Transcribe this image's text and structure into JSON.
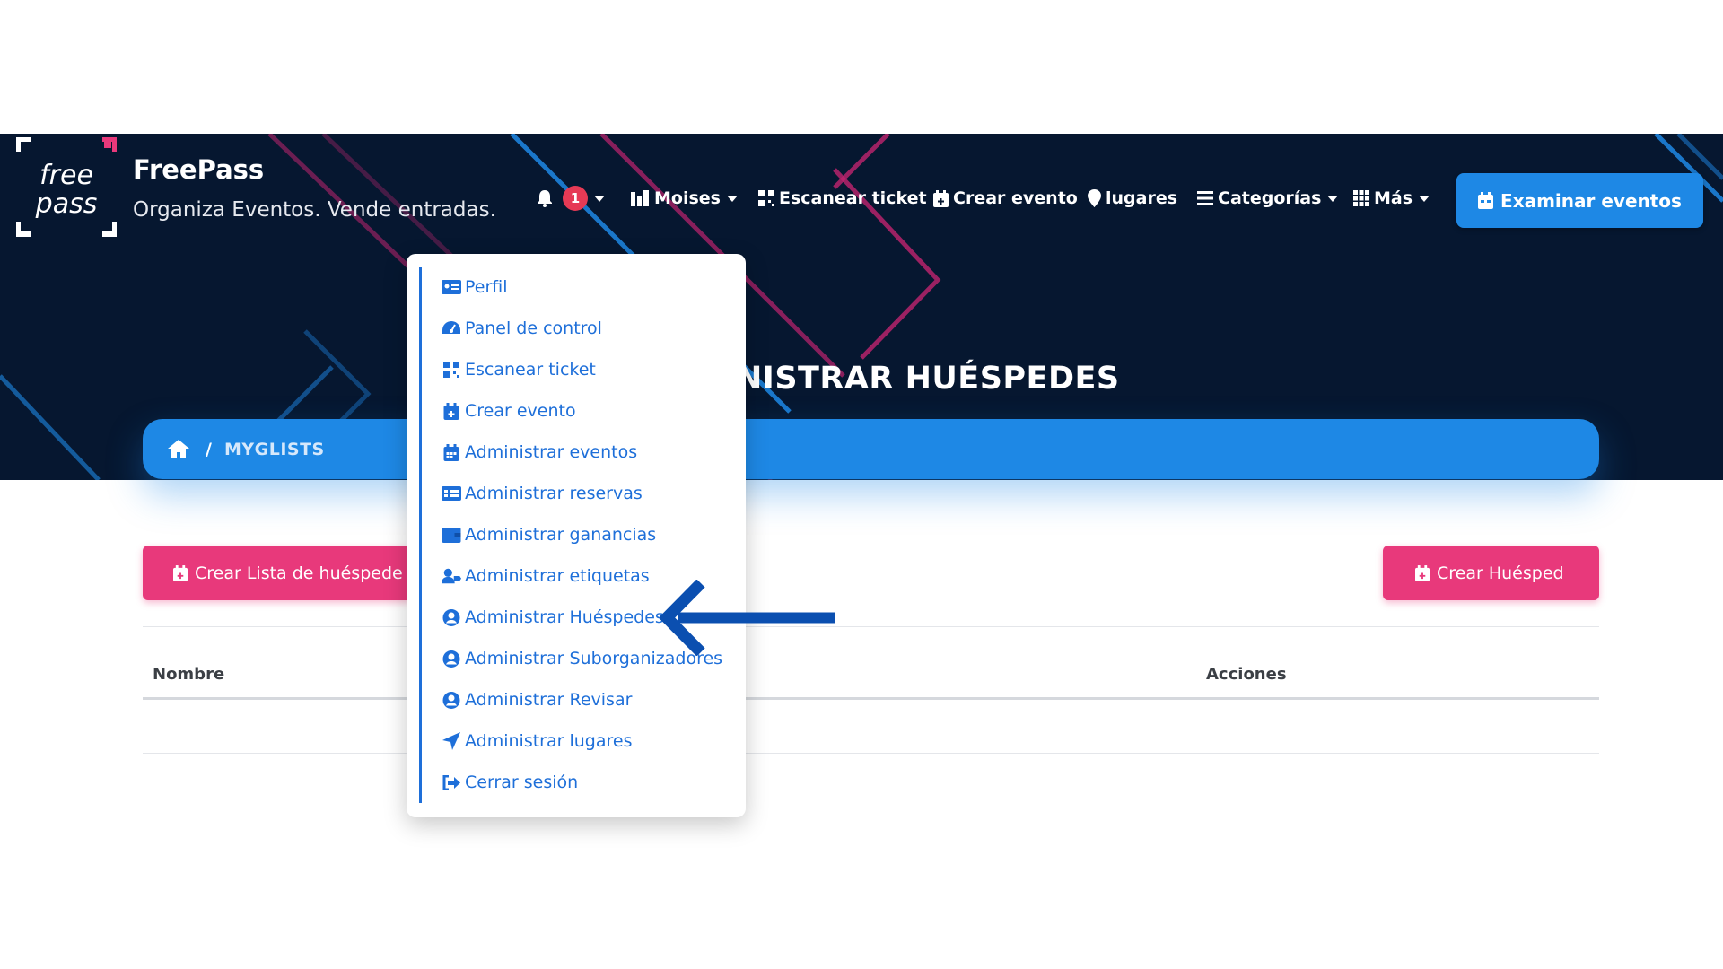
{
  "header": {
    "brand_name": "FreePass",
    "tagline": "Organiza Eventos. Vende entradas.",
    "logo_text_1": "free",
    "logo_text_2": "pass",
    "accent_color": "#e8397b"
  },
  "nav": {
    "notifications": {
      "icon": "bell-icon",
      "count": "1"
    },
    "user_menu": {
      "icon": "user-dashboard-icon",
      "label": "Moises"
    },
    "scan_ticket": {
      "icon": "qrcode-icon",
      "label": "Escanear ticket"
    },
    "create_event": {
      "icon": "calendar-plus-icon",
      "label": "Crear evento"
    },
    "venues": {
      "icon": "map-pin-icon",
      "label": "lugares"
    },
    "categories": {
      "icon": "list-icon",
      "label": "Categorías"
    },
    "more": {
      "icon": "grid-icon",
      "label": "Más"
    },
    "browse_events": {
      "icon": "calendar-icon",
      "label": "Examinar eventos",
      "color": "#1e88e5"
    }
  },
  "page": {
    "heading_visible": "NISTRAR HUÉSPEDES",
    "breadcrumb": {
      "home_icon": "home-icon",
      "separator": "/",
      "current": "MYGLISTS"
    }
  },
  "actions": {
    "create_list_label": "Crear Lista de huéspede",
    "create_guest_label": "Crear Huésped"
  },
  "table": {
    "columns": [
      "Nombre",
      "Acciones"
    ]
  },
  "dropdown": {
    "items": [
      {
        "icon": "id-card-icon",
        "label": "Perfil"
      },
      {
        "icon": "dashboard-gauge-icon",
        "label": "Panel de control"
      },
      {
        "icon": "qrcode-icon",
        "label": "Escanear ticket"
      },
      {
        "icon": "calendar-plus-icon",
        "label": "Crear evento"
      },
      {
        "icon": "calendar-icon",
        "label": "Administrar eventos"
      },
      {
        "icon": "list-card-icon",
        "label": "Administrar reservas"
      },
      {
        "icon": "wallet-icon",
        "label": "Administrar ganancias"
      },
      {
        "icon": "user-tag-icon",
        "label": "Administrar etiquetas"
      },
      {
        "icon": "user-circle-icon",
        "label": "Administrar Huéspedes"
      },
      {
        "icon": "user-circle-icon",
        "label": "Administrar Suborganizadores"
      },
      {
        "icon": "user-circle-icon",
        "label": "Administrar Revisar"
      },
      {
        "icon": "location-arrow-icon",
        "label": "Administrar lugares"
      },
      {
        "icon": "sign-out-icon",
        "label": "Cerrar sesión"
      }
    ],
    "accent_color": "#1e6fd9"
  },
  "annotation": {
    "arrow_color": "#0b4fb0",
    "points_to": "Administrar Huéspedes"
  }
}
